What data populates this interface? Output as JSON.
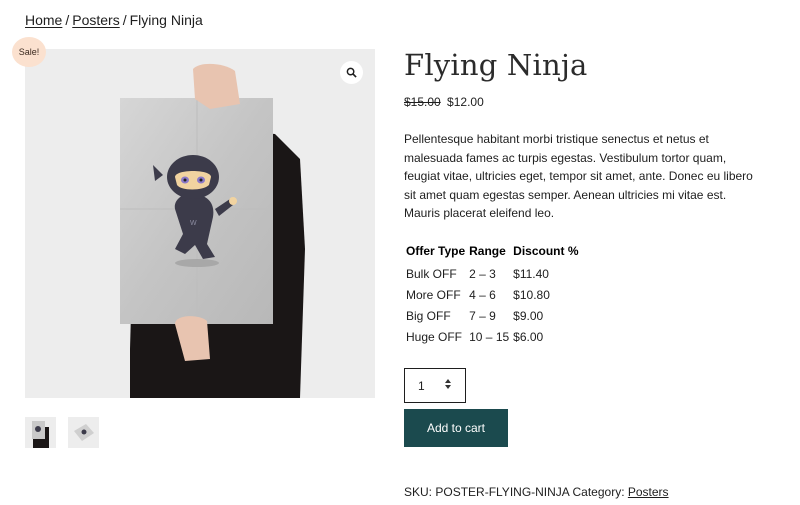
{
  "breadcrumb": {
    "home": "Home",
    "category": "Posters",
    "current": "Flying Ninja",
    "separator": "/"
  },
  "gallery": {
    "sale_badge": "Sale!",
    "zoom_icon": "magnifier-icon"
  },
  "product": {
    "title": "Flying Ninja",
    "old_price": "$15.00",
    "new_price": "$12.00",
    "description": "Pellentesque habitant morbi tristique senectus et netus et malesuada fames ac turpis egestas. Vestibulum tortor quam, feugiat vitae, ultricies eget, tempor sit amet, ante. Donec eu libero sit amet quam egestas semper. Aenean ultricies mi vitae est. Mauris placerat eleifend leo."
  },
  "offers": {
    "headers": [
      "Offer Type",
      "Range",
      "Discount %"
    ],
    "rows": [
      [
        "Bulk OFF",
        "2 – 3",
        "$11.40"
      ],
      [
        "More OFF",
        "4 – 6",
        "$10.80"
      ],
      [
        "Big OFF",
        "7 – 9",
        "$9.00"
      ],
      [
        "Huge OFF",
        "10 – 15",
        "$6.00"
      ]
    ]
  },
  "cart": {
    "quantity": "1",
    "add_label": "Add to cart"
  },
  "meta": {
    "sku_label": "SKU:",
    "sku": "POSTER-FLYING-NINJA",
    "category_label": "Category:",
    "category": "Posters"
  },
  "colors": {
    "button_bg": "#1b4a4e",
    "sale_badge_bg": "#fbe1cf",
    "gallery_bg": "#ededed"
  }
}
